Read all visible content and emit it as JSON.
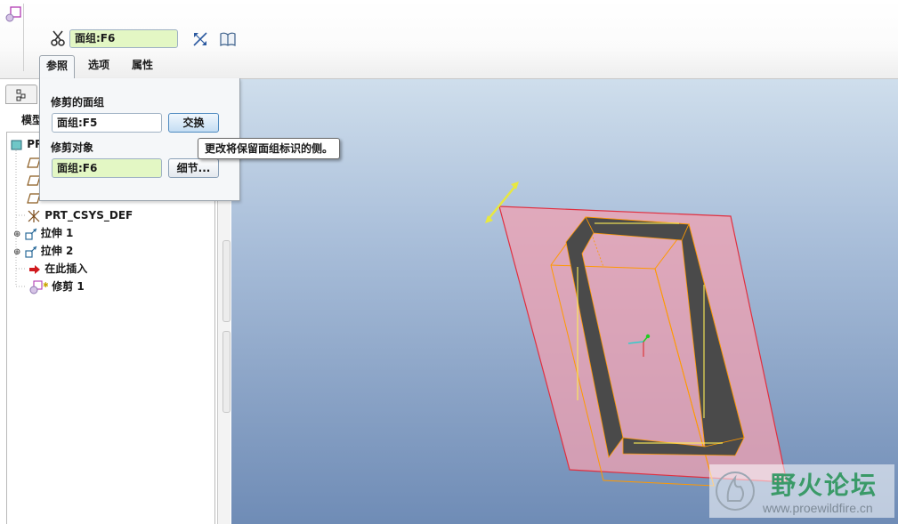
{
  "dashboard": {
    "quilt_value": "面组:F6",
    "tabs": [
      {
        "label": "参照",
        "selected": true
      },
      {
        "label": "选项",
        "selected": false
      },
      {
        "label": "属性",
        "selected": false
      }
    ],
    "icons": [
      "trim-feature-icon",
      "scissors-icon",
      "thicken-icon",
      "book-icon"
    ]
  },
  "references_panel": {
    "trimmed_quilt_label": "修剪的面组",
    "trimmed_quilt_value": "面组:F5",
    "swap_label": "交换",
    "trimming_object_label": "修剪对象",
    "trimming_object_value": "面组:F6",
    "details_label": "细节..."
  },
  "tooltip": "更改将保留面组标识的侧。",
  "model_tree": {
    "header": "模型",
    "items": [
      {
        "label": "PR",
        "icon": "part-icon"
      },
      {
        "label": "",
        "icon": "datum-plane-icon"
      },
      {
        "label": "",
        "icon": "datum-plane-icon"
      },
      {
        "label": "",
        "icon": "datum-plane-icon"
      },
      {
        "label": "PRT_CSYS_DEF",
        "icon": "csys-icon"
      },
      {
        "label": "拉伸 1",
        "icon": "extrude-icon",
        "expandable": true
      },
      {
        "label": "拉伸 2",
        "icon": "extrude-icon",
        "expandable": true
      },
      {
        "label": "在此插入",
        "icon": "insert-here-icon"
      },
      {
        "label": "修剪 1",
        "icon": "trim-feature-icon"
      }
    ]
  },
  "watermark": {
    "title": "野火论坛",
    "url": "www.proewildfire.cn"
  },
  "colors": {
    "quilt_field_bg": "#e3f7c4",
    "trim_plane_fill": "#f0a0b0",
    "trim_plane_edge": "#e03040",
    "wireframe": "#ff9900",
    "viewport_top": "#cfdeec",
    "viewport_bottom": "#6f8cb6"
  }
}
